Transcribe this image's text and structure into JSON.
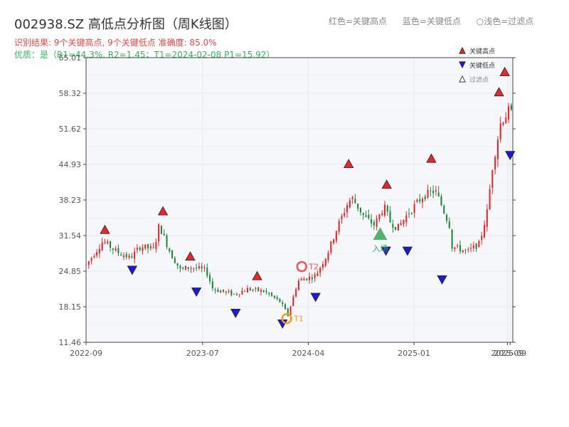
{
  "header": {
    "title": "002938.SZ 高低点分析图（周K线图）",
    "legend_red": "红色=关键高点",
    "legend_blue": "蓝色=关键低点",
    "legend_hollow": "○浅色=过滤点",
    "result_text": "识别结果: 9个关键高点, 9个关键低点  准确度: 85.0%",
    "quality_text": "优质：是（R1=44.3%, R2=1.45；T1=2024-02-08 P1=15.92）"
  },
  "colors": {
    "up": "#e8262b",
    "down": "#1a8a3a",
    "high_marker": "#e8262b",
    "low_marker": "#1b1bdc",
    "grid": "#e6e8ec",
    "plot_bg": "#f5f7fa",
    "t1": "#f0a020",
    "t2": "#ee5555",
    "entry": "#34a853",
    "result_text": "#ee4444",
    "quality_text": "#2fb65a"
  },
  "chart_data": {
    "type": "candlestick",
    "title": "002938.SZ 高低点分析图（周K线图）",
    "y_ticks": [
      11.46,
      18.15,
      24.85,
      31.54,
      38.23,
      44.93,
      51.62,
      58.32,
      65.01
    ],
    "ylim": [
      11.46,
      65.01
    ],
    "x_tick_labels": [
      "2022-09",
      "2023-07",
      "2024-04",
      "2025-01",
      "2025-09",
      "2025-09"
    ],
    "x_tick_dates": [
      "2022-09-01",
      "2023-07-01",
      "2024-04-01",
      "2025-01-01",
      "2025-09-01",
      "2025-09-08"
    ],
    "x_range": [
      "2022-09-01",
      "2025-09-15"
    ],
    "grid": true,
    "legend_position": "top-right",
    "legend": [
      {
        "label": "关键高点",
        "marker": "high"
      },
      {
        "label": "关键低点",
        "marker": "low"
      },
      {
        "label": "过滤点",
        "marker": "filtered"
      }
    ],
    "close_path": [
      [
        "2022-09-01",
        26.0
      ],
      [
        "2022-10-15",
        30.5
      ],
      [
        "2022-11-20",
        28.5
      ],
      [
        "2022-12-25",
        27.3
      ],
      [
        "2023-01-20",
        29.5
      ],
      [
        "2023-02-25",
        29.0
      ],
      [
        "2023-03-10",
        33.5
      ],
      [
        "2023-04-10",
        28.0
      ],
      [
        "2023-05-05",
        25.0
      ],
      [
        "2023-05-20",
        25.5
      ],
      [
        "2023-06-10",
        25.5
      ],
      [
        "2023-07-10",
        25.0
      ],
      [
        "2023-07-28",
        21.5
      ],
      [
        "2023-09-20",
        20.5
      ],
      [
        "2023-10-28",
        21.5
      ],
      [
        "2023-12-10",
        21.0
      ],
      [
        "2024-01-20",
        19.0
      ],
      [
        "2024-02-08",
        16.5
      ],
      [
        "2024-03-05",
        23.0
      ],
      [
        "2024-03-25",
        23.5
      ],
      [
        "2024-04-20",
        24.0
      ],
      [
        "2024-05-20",
        28.0
      ],
      [
        "2024-06-15",
        33.0
      ],
      [
        "2024-07-15",
        38.0
      ],
      [
        "2024-07-25",
        38.5
      ],
      [
        "2024-08-25",
        35.0
      ],
      [
        "2024-09-20",
        33.5
      ],
      [
        "2024-10-15",
        37.0
      ],
      [
        "2024-11-01",
        34.0
      ],
      [
        "2024-11-20",
        33.0
      ],
      [
        "2024-12-20",
        36.0
      ],
      [
        "2025-01-25",
        39.0
      ],
      [
        "2025-02-25",
        40.0
      ],
      [
        "2025-03-15",
        37.0
      ],
      [
        "2025-04-03",
        33.5
      ],
      [
        "2025-04-10",
        29.5
      ],
      [
        "2025-04-30",
        29.0
      ],
      [
        "2025-05-20",
        28.5
      ],
      [
        "2025-06-20",
        30.0
      ],
      [
        "2025-07-10",
        36.0
      ],
      [
        "2025-07-25",
        45.0
      ],
      [
        "2025-08-15",
        53.0
      ],
      [
        "2025-09-05",
        55.0
      ],
      [
        "2025-09-15",
        54.0
      ]
    ],
    "key_highs": [
      {
        "date": "2022-10-20",
        "price": 31.8
      },
      {
        "date": "2023-03-20",
        "price": 35.3
      },
      {
        "date": "2023-05-30",
        "price": 26.8
      },
      {
        "date": "2023-11-20",
        "price": 23.1
      },
      {
        "date": "2024-07-15",
        "price": 44.2
      },
      {
        "date": "2024-10-22",
        "price": 40.3
      },
      {
        "date": "2025-02-15",
        "price": 45.2
      },
      {
        "date": "2025-08-10",
        "price": 57.7
      },
      {
        "date": "2025-08-25",
        "price": 61.5
      }
    ],
    "key_lows": [
      {
        "date": "2022-12-30",
        "price": 25.9
      },
      {
        "date": "2023-06-15",
        "price": 21.8
      },
      {
        "date": "2023-09-25",
        "price": 17.8
      },
      {
        "date": "2024-01-25",
        "price": 15.8
      },
      {
        "date": "2024-04-20",
        "price": 20.8
      },
      {
        "date": "2024-10-20",
        "price": 29.5
      },
      {
        "date": "2024-12-15",
        "price": 29.5
      },
      {
        "date": "2025-03-15",
        "price": 24.1
      },
      {
        "date": "2025-09-08",
        "price": 47.5
      }
    ],
    "annotations": [
      {
        "label": "T1",
        "date": "2024-02-05",
        "price": 15.92
      },
      {
        "label": "T2",
        "date": "2024-03-15",
        "price": 25.7
      },
      {
        "label": "入场",
        "date": "2024-10-05",
        "price": 31.8
      }
    ]
  }
}
